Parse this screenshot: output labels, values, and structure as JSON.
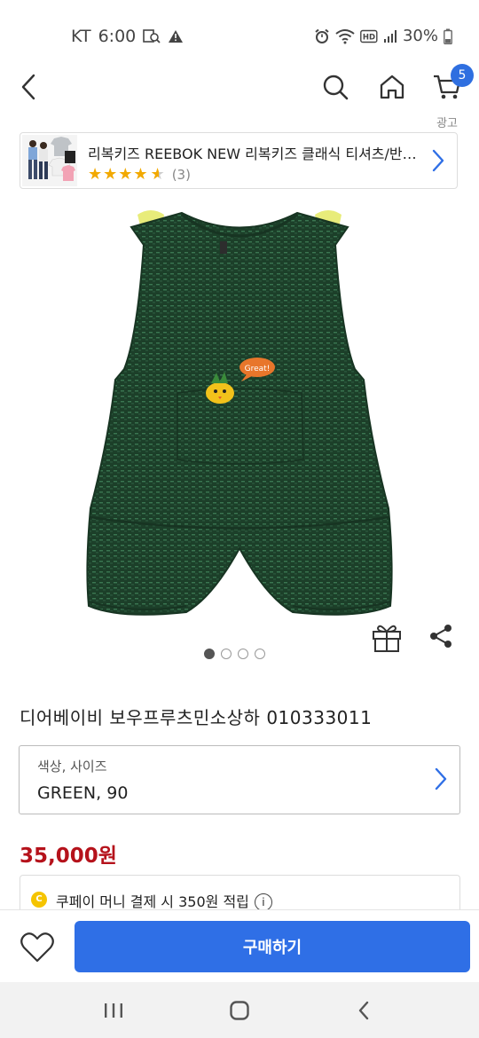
{
  "status_bar": {
    "carrier": "KT",
    "time": "6:00",
    "battery": "30%",
    "icons": [
      "search-image-icon",
      "warning-icon",
      "alarm-icon",
      "wifi-icon",
      "hd-icon",
      "signal-icon",
      "battery-icon"
    ]
  },
  "header": {
    "icons": [
      "back-icon",
      "search-icon",
      "home-icon",
      "cart-icon"
    ],
    "cart_count": "5",
    "ad_label": "광고"
  },
  "ad": {
    "title": "리복키즈 REEBOK NEW 리복키즈 클래식 티셔츠/반바지 세트",
    "rating": 4.5,
    "reviews": "(3)",
    "stars": "★★★★",
    "half_star": "★"
  },
  "gallery": {
    "total": 4,
    "current": 1
  },
  "product": {
    "title": "디어베이비 보우프루츠민소상하 010333011",
    "option_label": "색상, 사이즈",
    "option_value": "GREEN, 90",
    "price": "35,000원",
    "speech_bubble": "Great!"
  },
  "benefit": {
    "coin": "C",
    "text": "쿠페이 머니 결제 시 350원 적립",
    "info": "i"
  },
  "action_bar": {
    "buy_label": "구매하기"
  },
  "colors": {
    "accent": "#2f6fe6",
    "price": "#b5121b",
    "garment": "#1f4a2e"
  }
}
